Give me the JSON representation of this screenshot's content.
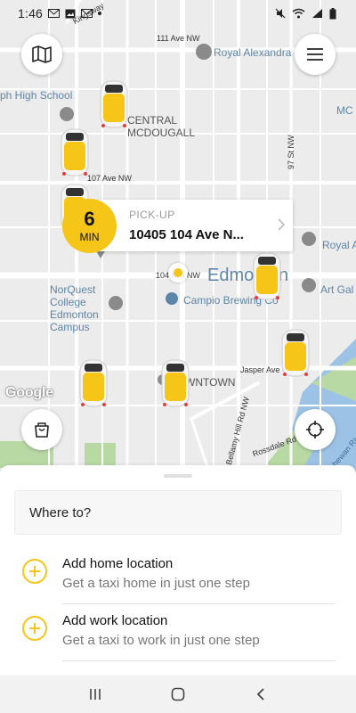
{
  "status_bar": {
    "time": "1:46",
    "icons": [
      "gmail-icon",
      "image-icon",
      "gmail-icon",
      "dot-icon",
      "mute-icon",
      "wifi-icon",
      "signal-icon",
      "battery-icon"
    ]
  },
  "map": {
    "labels": {
      "ave_111": "111 Ave NW",
      "royal_alexandra": "Royal Alexandra",
      "mc": "MC",
      "high_school": "ph High School",
      "central_mcdougall": "CENTRAL\nMCDOUGALL",
      "ave_107": "107 Ave NW",
      "st_97": "97 St NW",
      "royal_a": "Royal A",
      "edmonton": "Edmonton",
      "ave_104": "104 Ave NW",
      "norquest": "NorQuest\nCollege\nEdmonton\nCampus",
      "campio": "Campio Brewing Co",
      "art_gallery": "Art Gal",
      "jasper": "Jasper Ave",
      "downtown": "DOWNTOWN",
      "bellamy": "Bellamy Hill Rd NW",
      "rossdale": "Rossdale Rd NW",
      "saskatchewan": "Saskatchewan River",
      "ringwood": "Kingsway",
      "google": "Google"
    },
    "pickup": {
      "title": "PICK-UP",
      "address": "10405 104 Ave N..."
    },
    "eta": {
      "value": "6",
      "unit": "MIN"
    },
    "taxi_count": 8,
    "colors": {
      "accent": "#f5c518",
      "map_bg": "#ececec",
      "park": "#b9d9a4",
      "water": "#9cc3e6"
    }
  },
  "sheet": {
    "search_placeholder": "Where to?",
    "home": {
      "title": "Add home location",
      "subtitle": "Get a taxi home in just one step"
    },
    "work": {
      "title": "Add work location",
      "subtitle": "Get a taxi to work in just one step"
    }
  },
  "nav": {
    "icons": [
      "recent-apps-icon",
      "home-icon",
      "back-icon"
    ]
  }
}
